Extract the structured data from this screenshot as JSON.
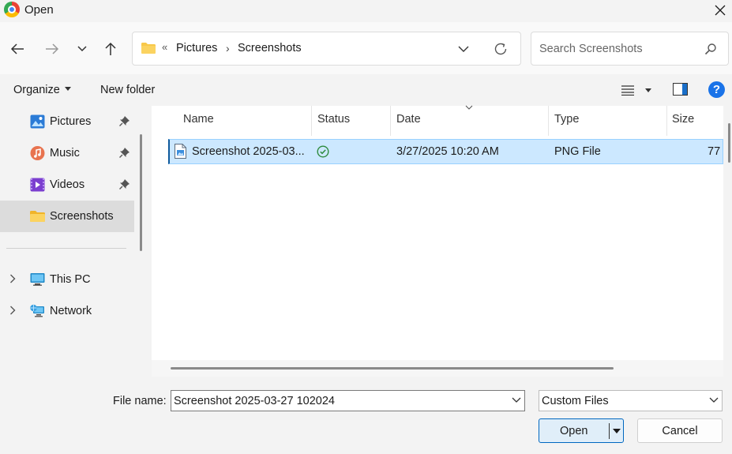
{
  "window": {
    "title": "Open"
  },
  "address": {
    "overflow_glyph": "«",
    "crumbs": [
      "Pictures",
      "Screenshots"
    ],
    "separator": "›"
  },
  "search": {
    "placeholder": "Search Screenshots"
  },
  "toolbar": {
    "organize_label": "Organize",
    "new_folder_label": "New folder",
    "help_label": "?"
  },
  "sidebar": {
    "items": [
      {
        "label": "Pictures",
        "icon": "pictures-icon",
        "pinned": true
      },
      {
        "label": "Music",
        "icon": "music-icon",
        "pinned": true
      },
      {
        "label": "Videos",
        "icon": "videos-icon",
        "pinned": true
      },
      {
        "label": "Screenshots",
        "icon": "folder-icon",
        "selected": true
      },
      {
        "label": "This PC",
        "icon": "computer-icon",
        "expandable": true
      },
      {
        "label": "Network",
        "icon": "network-icon",
        "expandable": true
      }
    ]
  },
  "columns": {
    "name": "Name",
    "status": "Status",
    "date": "Date",
    "type": "Type",
    "size": "Size"
  },
  "files": [
    {
      "name": "Screenshot 2025-03...",
      "status": "synced",
      "date": "3/27/2025 10:20 AM",
      "type": "PNG File",
      "size": "77"
    }
  ],
  "footer": {
    "filename_label": "File name:",
    "filename_value": "Screenshot 2025-03-27 102024",
    "filetype_value": "Custom Files",
    "open_label": "Open",
    "cancel_label": "Cancel"
  },
  "colors": {
    "accent": "#0067c0",
    "selection": "#cce8ff",
    "folder": "#f8c84a"
  }
}
